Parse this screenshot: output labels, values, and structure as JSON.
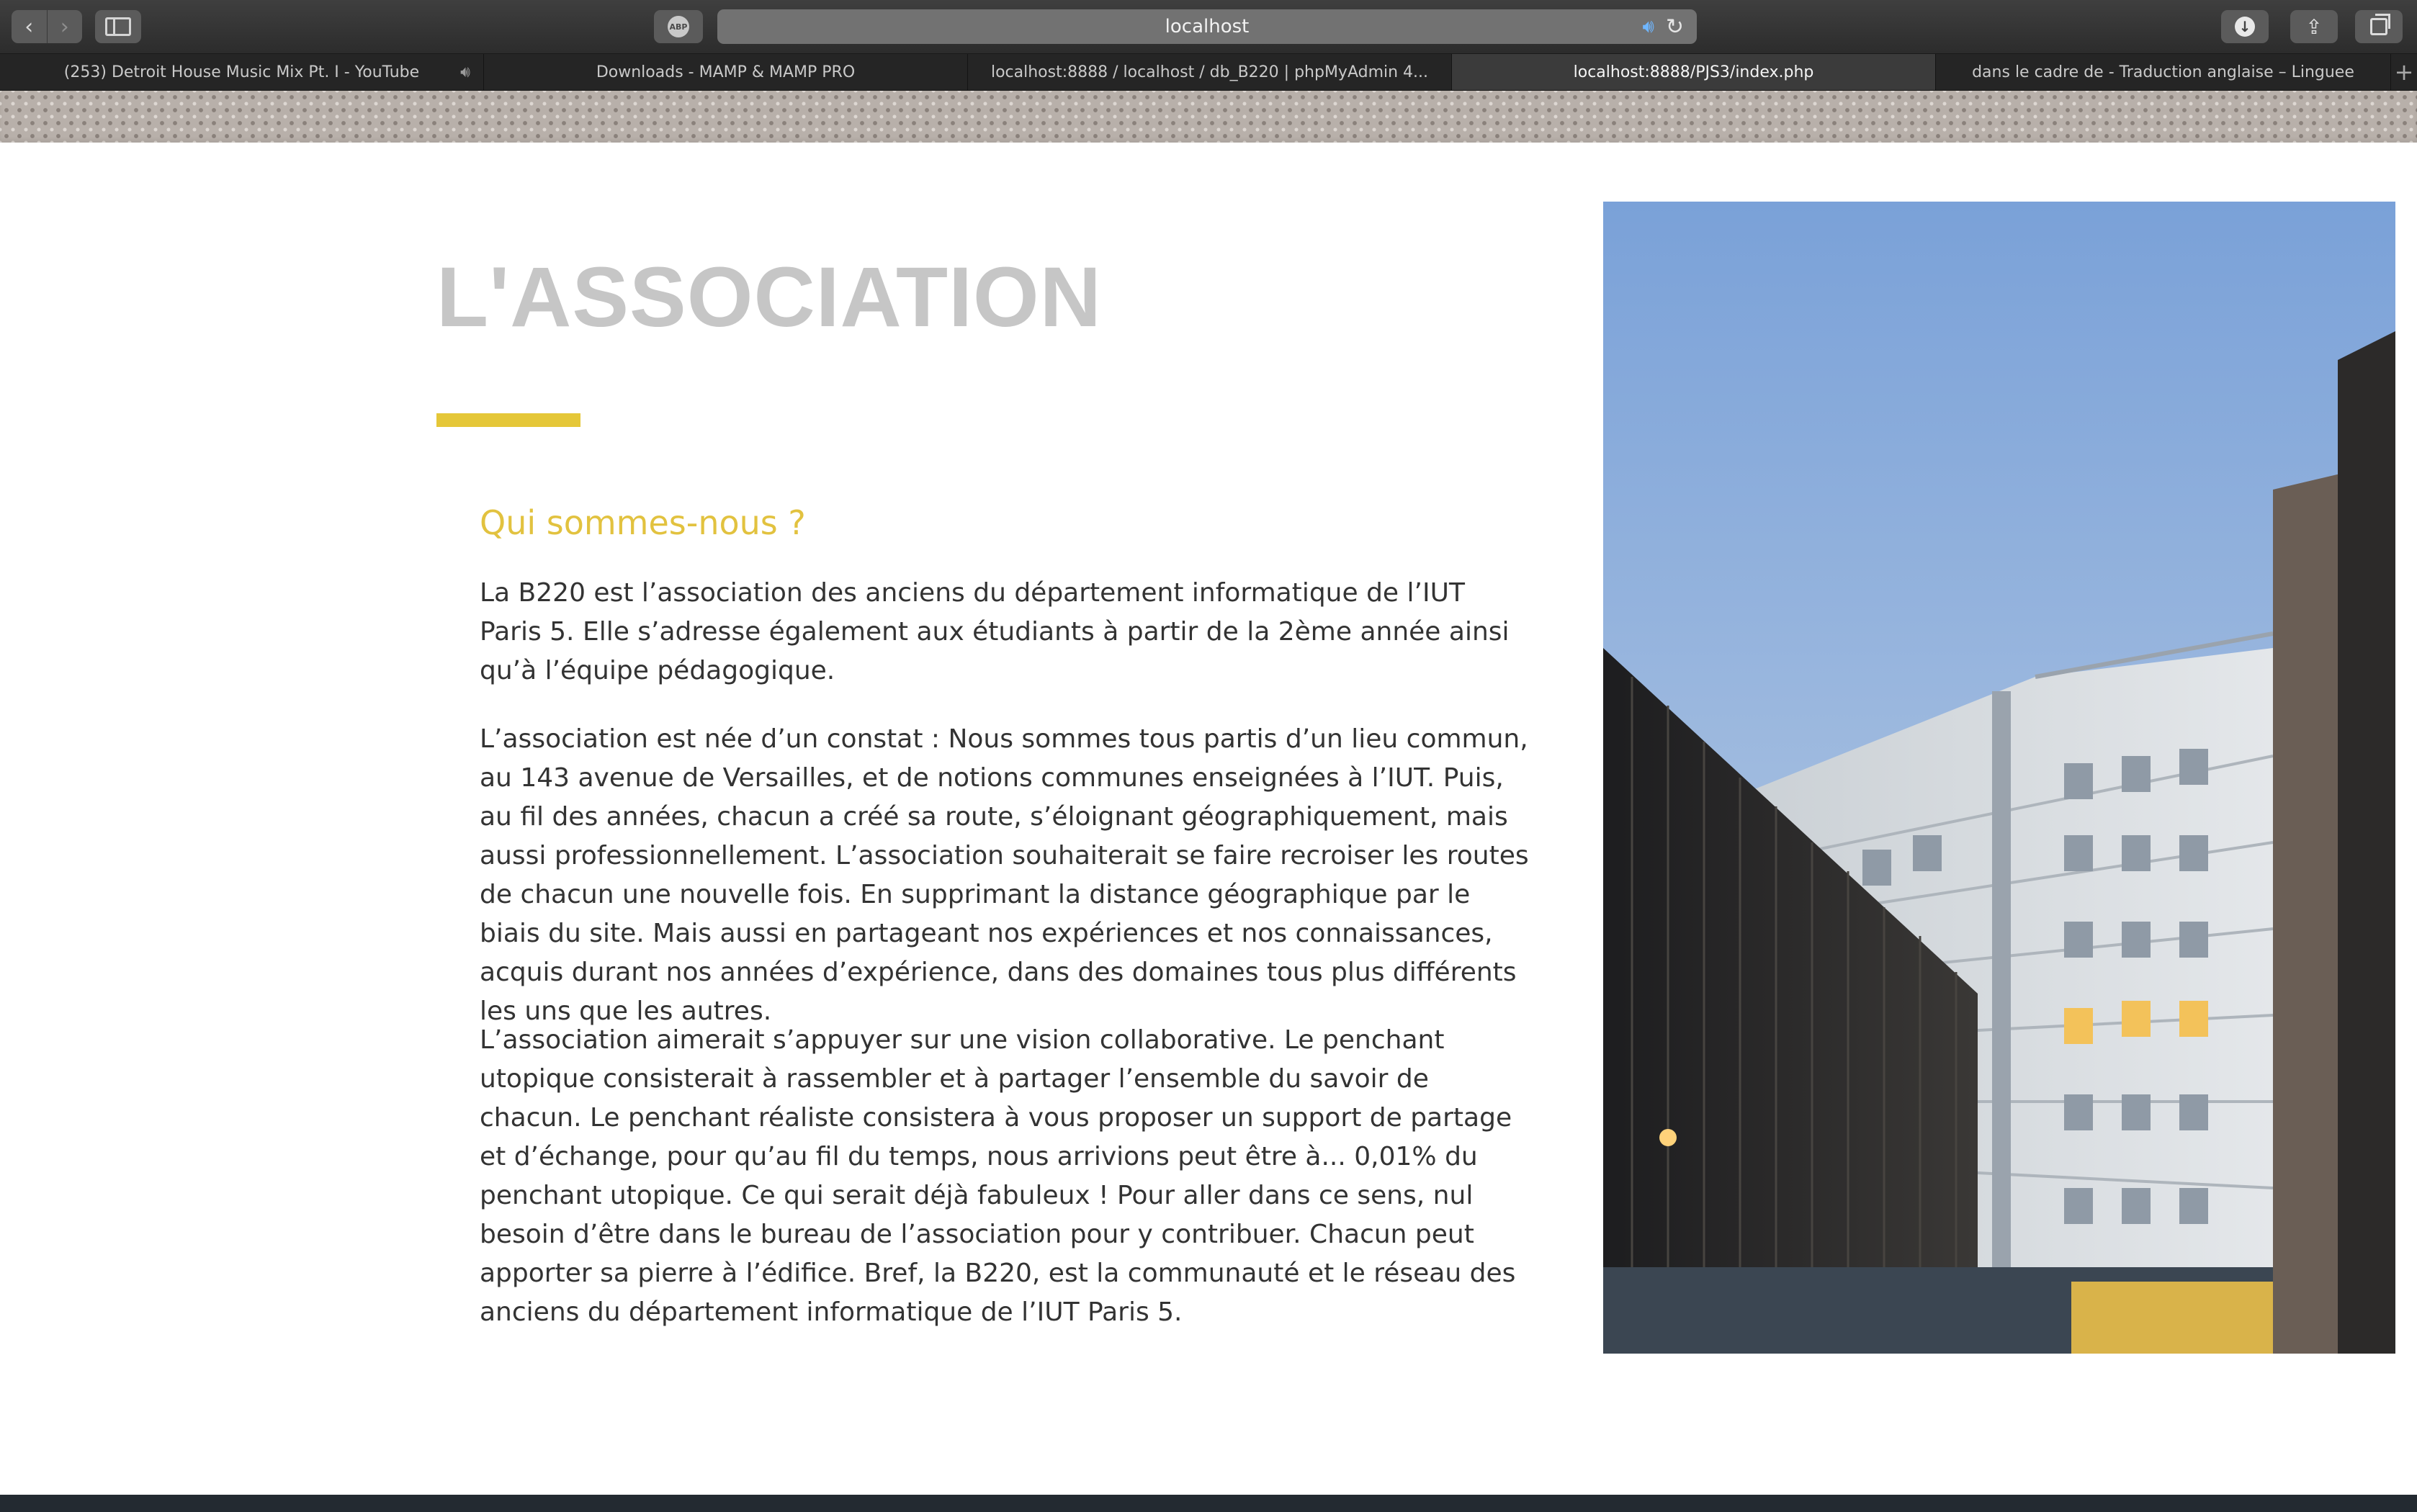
{
  "browser": {
    "address": "localhost",
    "tabs": [
      {
        "title": "(253) Detroit House Music Mix Pt. I - YouTube",
        "audio": true,
        "active": false
      },
      {
        "title": "Downloads - MAMP & MAMP PRO",
        "audio": false,
        "active": false
      },
      {
        "title": "localhost:8888 / localhost / db_B220 | phpMyAdmin 4...",
        "audio": false,
        "active": false
      },
      {
        "title": "localhost:8888/PJS3/index.php",
        "audio": false,
        "active": true
      },
      {
        "title": "dans le cadre de - Traduction anglaise – Linguee",
        "audio": false,
        "active": false
      }
    ],
    "icons": {
      "back": "chevron-left-icon",
      "forward": "chevron-right-icon",
      "sidebar": "sidebar-icon",
      "extension": "adblock-icon",
      "audio": "speaker-icon",
      "reload": "reload-icon",
      "downloads": "download-icon",
      "share": "share-icon",
      "tabs": "tab-overview-icon",
      "new_tab": "plus-icon"
    },
    "extension_label": "ABP"
  },
  "section": {
    "title": "L'ASSOCIATION",
    "subtitle": "Qui sommes-nous ?",
    "paragraphs": [
      "La B220 est l’association des anciens du département informatique de l’IUT Paris 5. Elle s’adresse également aux étudiants à partir de la 2ème année ainsi qu’à l’équipe pédagogique.",
      "L’association est née d’un constat : Nous sommes tous partis d’un lieu commun, au 143 avenue de Versailles, et de notions communes enseignées à l’IUT. Puis, au fil des années, chacun a créé sa route, s’éloignant géographiquement, mais aussi professionnellement. L’association souhaiterait se faire recroiser les routes de chacun une nouvelle fois. En supprimant la distance géographique par le biais du site. Mais aussi en partageant nos expériences et nos connaissances, acquis durant nos années d’expérience, dans des domaines tous plus différents les uns que les autres.",
      "L’association aimerait s’appuyer sur une vision collaborative. Le penchant utopique consisterait à rassembler et à partager l’ensemble du savoir de chacun. Le penchant réaliste consistera à vous proposer un support de partage et d’échange, pour qu’au fil du temps, nous arrivions peut être à... 0,01% du penchant utopique. Ce qui serait déjà fabuleux ! Pour aller dans ce sens, nul besoin d’être dans le bureau de l’association pour y contribuer. Chacun peut apporter sa pierre à l’édifice. Bref, la B220, est la communauté et le réseau des anciens du département informatique de l’IUT Paris 5."
    ]
  },
  "colors": {
    "accent": "#e5c738",
    "title": "#c6c6c6",
    "subtitle": "#e2c23f",
    "body_text": "#333333"
  }
}
